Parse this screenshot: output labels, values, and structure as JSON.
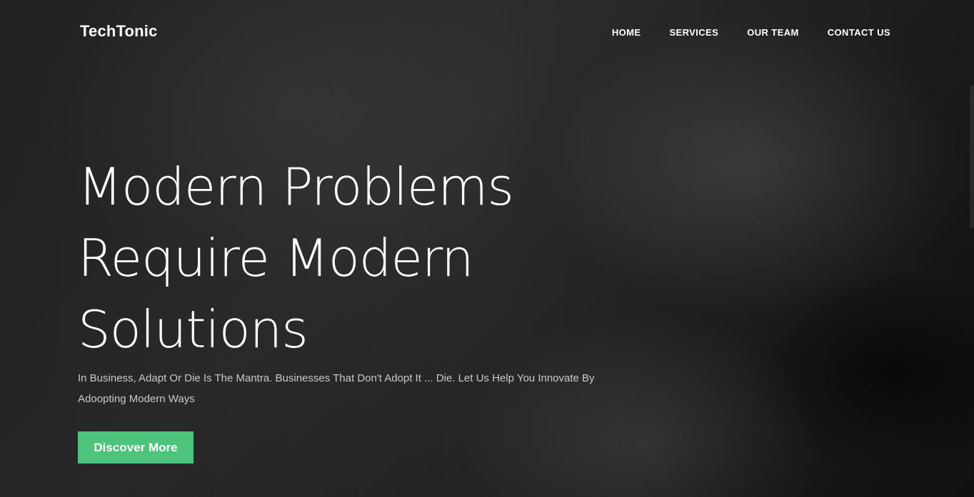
{
  "brand": {
    "name": "TechTonic"
  },
  "nav": {
    "items": [
      "HOME",
      "SERVICES",
      "OUR TEAM",
      "CONTACT US"
    ]
  },
  "hero": {
    "headline_lines": [
      "Modern Problems",
      "Require Modern",
      "Solutions"
    ],
    "subtext": "In Business, Adapt Or Die Is The Mantra. Businesses That Don't Adopt It ... Die. Let Us Help You Innovate By Adoopting Modern Ways",
    "cta_label": "Discover More"
  },
  "colors": {
    "accent": "#4dc37b",
    "text": "#ffffff",
    "muted_text": "#c9c9c9",
    "background": "#262626"
  }
}
